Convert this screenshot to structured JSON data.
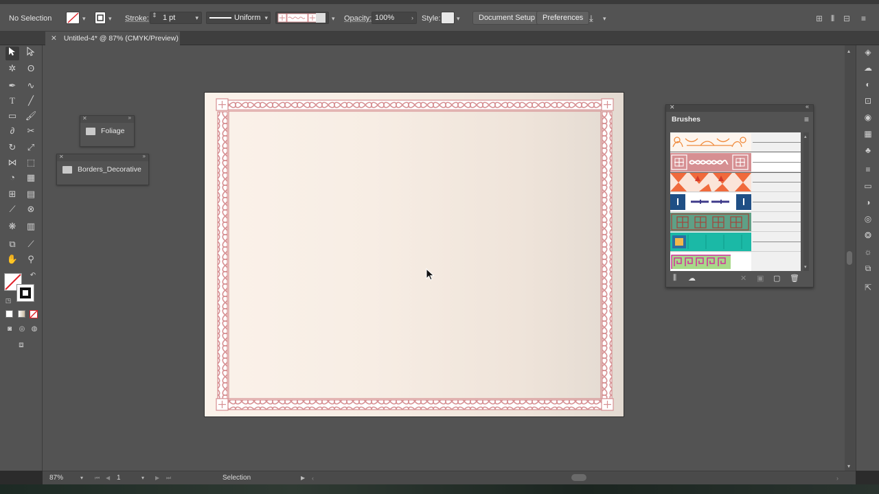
{
  "control_bar": {
    "selection_label": "No Selection",
    "stroke_label": "Stroke:",
    "stroke_value": "1 pt",
    "profile_label": "Uniform",
    "opacity_label": "Opacity:",
    "opacity_value": "100%",
    "style_label": "Style:",
    "document_setup_label": "Document Setup",
    "preferences_label": "Preferences"
  },
  "document_tab": {
    "title": "Untitled-4* @ 87% (CMYK/Preview)"
  },
  "floating_panels": {
    "foliage_label": "Foliage",
    "borders_label": "Borders_Decorative"
  },
  "brushes_panel": {
    "title": "Brushes",
    "rows": [
      {
        "name": "ornate-orange",
        "selected": false
      },
      {
        "name": "rope-pink",
        "selected": true
      },
      {
        "name": "orange-triangles",
        "selected": false
      },
      {
        "name": "blue-dash",
        "selected": false
      },
      {
        "name": "green-grid",
        "selected": false
      },
      {
        "name": "teal-block",
        "selected": false
      },
      {
        "name": "greek-key",
        "selected": false
      }
    ]
  },
  "status_bar": {
    "zoom_value": "87%",
    "artboard_number": "1",
    "tool_status": "Selection"
  },
  "colors": {
    "ui_panel": "#535353",
    "border_pink": "#d68f92",
    "artboard_light": "#fbf2ea",
    "artboard_dark": "#e3dad1"
  },
  "icons": {
    "left_tools": [
      "selection-arrow",
      "direct-selection",
      "magic-wand",
      "lasso",
      "pen",
      "curvature",
      "type",
      "line-segment",
      "rectangle",
      "paintbrush",
      "shaper",
      "eraser",
      "rotate",
      "scale",
      "width",
      "free-transform",
      "shape-builder",
      "perspective-grid",
      "mesh",
      "gradient",
      "eyedropper",
      "blend",
      "symbol-sprayer",
      "column-graph",
      "artboard",
      "slice",
      "hand",
      "zoom"
    ],
    "right_dock": [
      "layers",
      "libraries",
      "appearance",
      "properties",
      "color",
      "swatches",
      "brushes",
      "symbols",
      "align",
      "transform",
      "gradient",
      "transparency",
      "graphic-styles",
      "stroke",
      "pathfinder",
      "export"
    ]
  }
}
